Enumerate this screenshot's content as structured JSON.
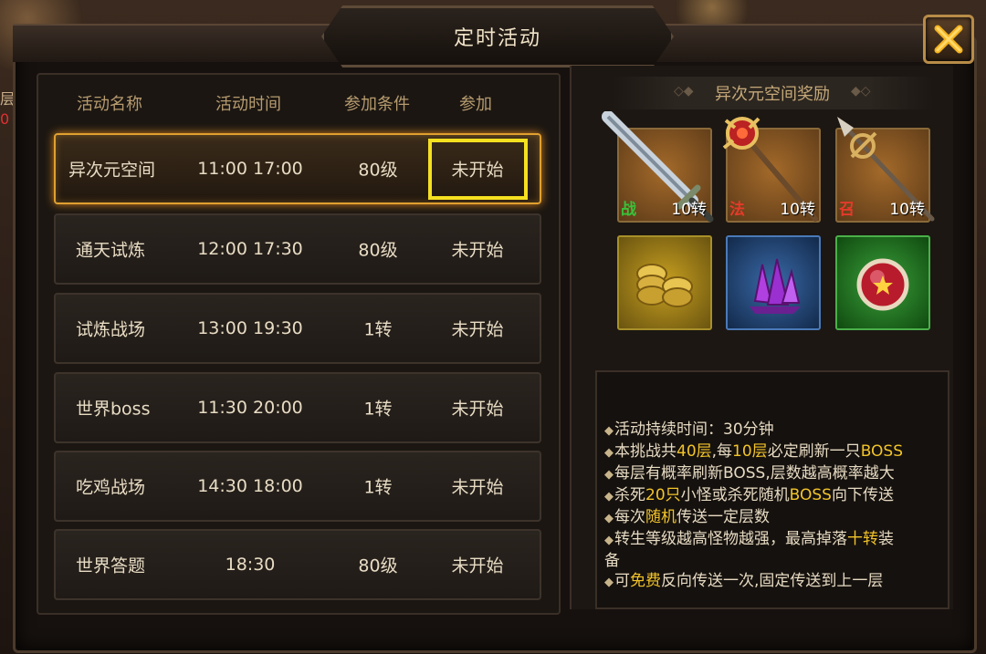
{
  "window": {
    "title": "定时活动"
  },
  "side_hint": {
    "top": "层",
    "bottom": "0"
  },
  "columns": [
    "活动名称",
    "活动时间",
    "参加条件",
    "参加"
  ],
  "activities": [
    {
      "name": "异次元空间",
      "time": "11:00  17:00",
      "requirement": "80级",
      "status": "未开始",
      "selected": true
    },
    {
      "name": "通天试炼",
      "time": "12:00  17:30",
      "requirement": "80级",
      "status": "未开始"
    },
    {
      "name": "试炼战场",
      "time": "13:00  19:30",
      "requirement": "1转",
      "status": "未开始"
    },
    {
      "name": "世界boss",
      "time": "11:30  20:00",
      "requirement": "1转",
      "status": "未开始"
    },
    {
      "name": "吃鸡战场",
      "time": "14:30  18:00",
      "requirement": "1转",
      "status": "未开始"
    },
    {
      "name": "世界答题",
      "time": "18:30",
      "requirement": "80级",
      "status": "未开始"
    }
  ],
  "reward_panel": {
    "title": "异次元空间奖励",
    "items": [
      {
        "icon": "sword-icon",
        "tag": "战",
        "tag_color": "#39c13a",
        "level": "10转"
      },
      {
        "icon": "staff-icon",
        "tag": "法",
        "tag_color": "#e43a2a",
        "level": "10转"
      },
      {
        "icon": "spear-icon",
        "tag": "召",
        "tag_color": "#e43a2a",
        "level": "10转"
      },
      {
        "icon": "gold-coins-icon"
      },
      {
        "icon": "purple-crystal-icon"
      },
      {
        "icon": "red-orb-icon"
      }
    ],
    "description": [
      {
        "parts": [
          "活动持续时间：30分钟"
        ]
      },
      {
        "parts": [
          "本挑战共",
          "40层",
          ",每",
          "10层",
          "必定刷新一只",
          "BOSS"
        ]
      },
      {
        "parts": [
          "每层有概率刷新BOSS,层数越高概率越大"
        ]
      },
      {
        "parts": [
          "杀死",
          "20只",
          "小怪或杀死随机",
          "BOSS",
          "向下传送"
        ]
      },
      {
        "parts": [
          "每次",
          "随机",
          "传送一定层数"
        ]
      },
      {
        "parts": [
          "转生等级越高怪物越强，最高掉落",
          "十转",
          "装"
        ]
      },
      {
        "parts": [
          "备"
        ],
        "no_bullet": true
      },
      {
        "parts": [
          "可",
          "免费",
          "反向传送一次,固定传送到上一层"
        ]
      }
    ]
  }
}
